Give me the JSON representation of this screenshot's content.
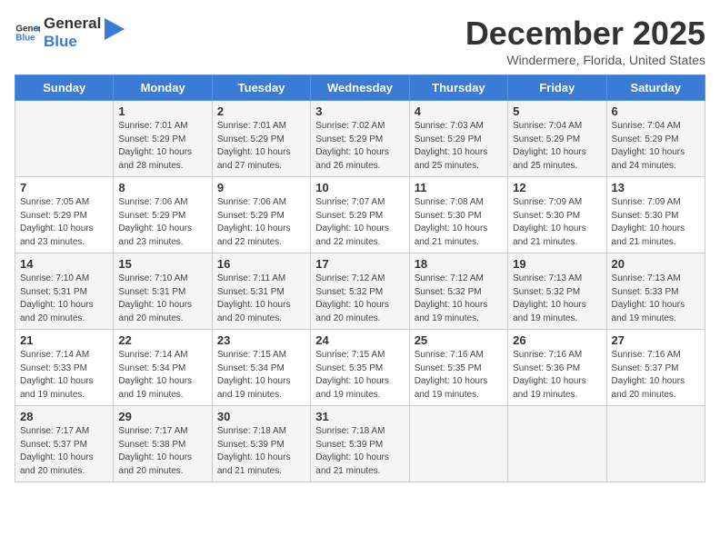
{
  "header": {
    "logo_general": "General",
    "logo_blue": "Blue",
    "month": "December 2025",
    "location": "Windermere, Florida, United States"
  },
  "days_of_week": [
    "Sunday",
    "Monday",
    "Tuesday",
    "Wednesday",
    "Thursday",
    "Friday",
    "Saturday"
  ],
  "weeks": [
    [
      {
        "day": "",
        "info": ""
      },
      {
        "day": "1",
        "info": "Sunrise: 7:01 AM\nSunset: 5:29 PM\nDaylight: 10 hours\nand 28 minutes."
      },
      {
        "day": "2",
        "info": "Sunrise: 7:01 AM\nSunset: 5:29 PM\nDaylight: 10 hours\nand 27 minutes."
      },
      {
        "day": "3",
        "info": "Sunrise: 7:02 AM\nSunset: 5:29 PM\nDaylight: 10 hours\nand 26 minutes."
      },
      {
        "day": "4",
        "info": "Sunrise: 7:03 AM\nSunset: 5:29 PM\nDaylight: 10 hours\nand 25 minutes."
      },
      {
        "day": "5",
        "info": "Sunrise: 7:04 AM\nSunset: 5:29 PM\nDaylight: 10 hours\nand 25 minutes."
      },
      {
        "day": "6",
        "info": "Sunrise: 7:04 AM\nSunset: 5:29 PM\nDaylight: 10 hours\nand 24 minutes."
      }
    ],
    [
      {
        "day": "7",
        "info": "Sunrise: 7:05 AM\nSunset: 5:29 PM\nDaylight: 10 hours\nand 23 minutes."
      },
      {
        "day": "8",
        "info": "Sunrise: 7:06 AM\nSunset: 5:29 PM\nDaylight: 10 hours\nand 23 minutes."
      },
      {
        "day": "9",
        "info": "Sunrise: 7:06 AM\nSunset: 5:29 PM\nDaylight: 10 hours\nand 22 minutes."
      },
      {
        "day": "10",
        "info": "Sunrise: 7:07 AM\nSunset: 5:29 PM\nDaylight: 10 hours\nand 22 minutes."
      },
      {
        "day": "11",
        "info": "Sunrise: 7:08 AM\nSunset: 5:30 PM\nDaylight: 10 hours\nand 21 minutes."
      },
      {
        "day": "12",
        "info": "Sunrise: 7:09 AM\nSunset: 5:30 PM\nDaylight: 10 hours\nand 21 minutes."
      },
      {
        "day": "13",
        "info": "Sunrise: 7:09 AM\nSunset: 5:30 PM\nDaylight: 10 hours\nand 21 minutes."
      }
    ],
    [
      {
        "day": "14",
        "info": "Sunrise: 7:10 AM\nSunset: 5:31 PM\nDaylight: 10 hours\nand 20 minutes."
      },
      {
        "day": "15",
        "info": "Sunrise: 7:10 AM\nSunset: 5:31 PM\nDaylight: 10 hours\nand 20 minutes."
      },
      {
        "day": "16",
        "info": "Sunrise: 7:11 AM\nSunset: 5:31 PM\nDaylight: 10 hours\nand 20 minutes."
      },
      {
        "day": "17",
        "info": "Sunrise: 7:12 AM\nSunset: 5:32 PM\nDaylight: 10 hours\nand 20 minutes."
      },
      {
        "day": "18",
        "info": "Sunrise: 7:12 AM\nSunset: 5:32 PM\nDaylight: 10 hours\nand 19 minutes."
      },
      {
        "day": "19",
        "info": "Sunrise: 7:13 AM\nSunset: 5:32 PM\nDaylight: 10 hours\nand 19 minutes."
      },
      {
        "day": "20",
        "info": "Sunrise: 7:13 AM\nSunset: 5:33 PM\nDaylight: 10 hours\nand 19 minutes."
      }
    ],
    [
      {
        "day": "21",
        "info": "Sunrise: 7:14 AM\nSunset: 5:33 PM\nDaylight: 10 hours\nand 19 minutes."
      },
      {
        "day": "22",
        "info": "Sunrise: 7:14 AM\nSunset: 5:34 PM\nDaylight: 10 hours\nand 19 minutes."
      },
      {
        "day": "23",
        "info": "Sunrise: 7:15 AM\nSunset: 5:34 PM\nDaylight: 10 hours\nand 19 minutes."
      },
      {
        "day": "24",
        "info": "Sunrise: 7:15 AM\nSunset: 5:35 PM\nDaylight: 10 hours\nand 19 minutes."
      },
      {
        "day": "25",
        "info": "Sunrise: 7:16 AM\nSunset: 5:35 PM\nDaylight: 10 hours\nand 19 minutes."
      },
      {
        "day": "26",
        "info": "Sunrise: 7:16 AM\nSunset: 5:36 PM\nDaylight: 10 hours\nand 19 minutes."
      },
      {
        "day": "27",
        "info": "Sunrise: 7:16 AM\nSunset: 5:37 PM\nDaylight: 10 hours\nand 20 minutes."
      }
    ],
    [
      {
        "day": "28",
        "info": "Sunrise: 7:17 AM\nSunset: 5:37 PM\nDaylight: 10 hours\nand 20 minutes."
      },
      {
        "day": "29",
        "info": "Sunrise: 7:17 AM\nSunset: 5:38 PM\nDaylight: 10 hours\nand 20 minutes."
      },
      {
        "day": "30",
        "info": "Sunrise: 7:18 AM\nSunset: 5:39 PM\nDaylight: 10 hours\nand 21 minutes."
      },
      {
        "day": "31",
        "info": "Sunrise: 7:18 AM\nSunset: 5:39 PM\nDaylight: 10 hours\nand 21 minutes."
      },
      {
        "day": "",
        "info": ""
      },
      {
        "day": "",
        "info": ""
      },
      {
        "day": "",
        "info": ""
      }
    ]
  ]
}
